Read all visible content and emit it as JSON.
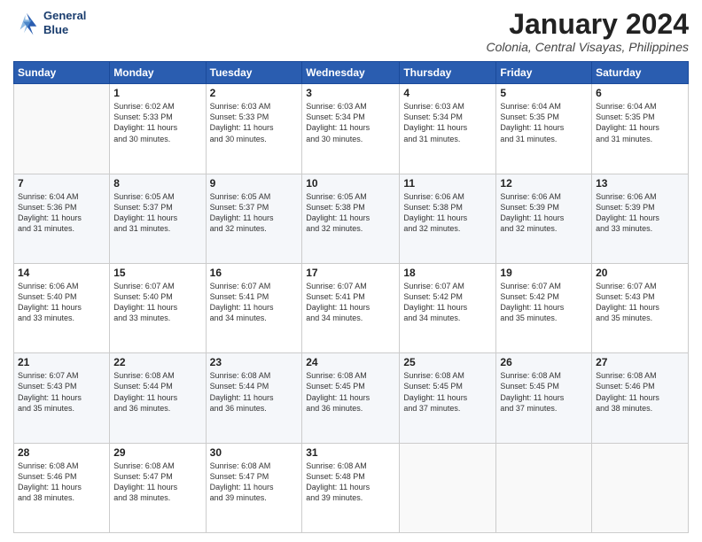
{
  "logo": {
    "line1": "General",
    "line2": "Blue"
  },
  "title": "January 2024",
  "subtitle": "Colonia, Central Visayas, Philippines",
  "header_days": [
    "Sunday",
    "Monday",
    "Tuesday",
    "Wednesday",
    "Thursday",
    "Friday",
    "Saturday"
  ],
  "weeks": [
    [
      {
        "day": "",
        "info": ""
      },
      {
        "day": "1",
        "info": "Sunrise: 6:02 AM\nSunset: 5:33 PM\nDaylight: 11 hours\nand 30 minutes."
      },
      {
        "day": "2",
        "info": "Sunrise: 6:03 AM\nSunset: 5:33 PM\nDaylight: 11 hours\nand 30 minutes."
      },
      {
        "day": "3",
        "info": "Sunrise: 6:03 AM\nSunset: 5:34 PM\nDaylight: 11 hours\nand 30 minutes."
      },
      {
        "day": "4",
        "info": "Sunrise: 6:03 AM\nSunset: 5:34 PM\nDaylight: 11 hours\nand 31 minutes."
      },
      {
        "day": "5",
        "info": "Sunrise: 6:04 AM\nSunset: 5:35 PM\nDaylight: 11 hours\nand 31 minutes."
      },
      {
        "day": "6",
        "info": "Sunrise: 6:04 AM\nSunset: 5:35 PM\nDaylight: 11 hours\nand 31 minutes."
      }
    ],
    [
      {
        "day": "7",
        "info": "Sunrise: 6:04 AM\nSunset: 5:36 PM\nDaylight: 11 hours\nand 31 minutes."
      },
      {
        "day": "8",
        "info": "Sunrise: 6:05 AM\nSunset: 5:37 PM\nDaylight: 11 hours\nand 31 minutes."
      },
      {
        "day": "9",
        "info": "Sunrise: 6:05 AM\nSunset: 5:37 PM\nDaylight: 11 hours\nand 32 minutes."
      },
      {
        "day": "10",
        "info": "Sunrise: 6:05 AM\nSunset: 5:38 PM\nDaylight: 11 hours\nand 32 minutes."
      },
      {
        "day": "11",
        "info": "Sunrise: 6:06 AM\nSunset: 5:38 PM\nDaylight: 11 hours\nand 32 minutes."
      },
      {
        "day": "12",
        "info": "Sunrise: 6:06 AM\nSunset: 5:39 PM\nDaylight: 11 hours\nand 32 minutes."
      },
      {
        "day": "13",
        "info": "Sunrise: 6:06 AM\nSunset: 5:39 PM\nDaylight: 11 hours\nand 33 minutes."
      }
    ],
    [
      {
        "day": "14",
        "info": "Sunrise: 6:06 AM\nSunset: 5:40 PM\nDaylight: 11 hours\nand 33 minutes."
      },
      {
        "day": "15",
        "info": "Sunrise: 6:07 AM\nSunset: 5:40 PM\nDaylight: 11 hours\nand 33 minutes."
      },
      {
        "day": "16",
        "info": "Sunrise: 6:07 AM\nSunset: 5:41 PM\nDaylight: 11 hours\nand 34 minutes."
      },
      {
        "day": "17",
        "info": "Sunrise: 6:07 AM\nSunset: 5:41 PM\nDaylight: 11 hours\nand 34 minutes."
      },
      {
        "day": "18",
        "info": "Sunrise: 6:07 AM\nSunset: 5:42 PM\nDaylight: 11 hours\nand 34 minutes."
      },
      {
        "day": "19",
        "info": "Sunrise: 6:07 AM\nSunset: 5:42 PM\nDaylight: 11 hours\nand 35 minutes."
      },
      {
        "day": "20",
        "info": "Sunrise: 6:07 AM\nSunset: 5:43 PM\nDaylight: 11 hours\nand 35 minutes."
      }
    ],
    [
      {
        "day": "21",
        "info": "Sunrise: 6:07 AM\nSunset: 5:43 PM\nDaylight: 11 hours\nand 35 minutes."
      },
      {
        "day": "22",
        "info": "Sunrise: 6:08 AM\nSunset: 5:44 PM\nDaylight: 11 hours\nand 36 minutes."
      },
      {
        "day": "23",
        "info": "Sunrise: 6:08 AM\nSunset: 5:44 PM\nDaylight: 11 hours\nand 36 minutes."
      },
      {
        "day": "24",
        "info": "Sunrise: 6:08 AM\nSunset: 5:45 PM\nDaylight: 11 hours\nand 36 minutes."
      },
      {
        "day": "25",
        "info": "Sunrise: 6:08 AM\nSunset: 5:45 PM\nDaylight: 11 hours\nand 37 minutes."
      },
      {
        "day": "26",
        "info": "Sunrise: 6:08 AM\nSunset: 5:45 PM\nDaylight: 11 hours\nand 37 minutes."
      },
      {
        "day": "27",
        "info": "Sunrise: 6:08 AM\nSunset: 5:46 PM\nDaylight: 11 hours\nand 38 minutes."
      }
    ],
    [
      {
        "day": "28",
        "info": "Sunrise: 6:08 AM\nSunset: 5:46 PM\nDaylight: 11 hours\nand 38 minutes."
      },
      {
        "day": "29",
        "info": "Sunrise: 6:08 AM\nSunset: 5:47 PM\nDaylight: 11 hours\nand 38 minutes."
      },
      {
        "day": "30",
        "info": "Sunrise: 6:08 AM\nSunset: 5:47 PM\nDaylight: 11 hours\nand 39 minutes."
      },
      {
        "day": "31",
        "info": "Sunrise: 6:08 AM\nSunset: 5:48 PM\nDaylight: 11 hours\nand 39 minutes."
      },
      {
        "day": "",
        "info": ""
      },
      {
        "day": "",
        "info": ""
      },
      {
        "day": "",
        "info": ""
      }
    ]
  ]
}
